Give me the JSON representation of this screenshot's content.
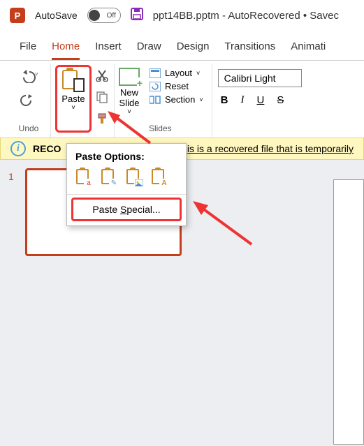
{
  "titlebar": {
    "app_letter": "P",
    "autosave_label": "AutoSave",
    "autosave_state": "Off",
    "doc_title": "ppt14BB.pptm - AutoRecovered • Savec"
  },
  "tabs": {
    "file": "File",
    "home": "Home",
    "insert": "Insert",
    "draw": "Draw",
    "design": "Design",
    "transitions": "Transitions",
    "animations": "Animati"
  },
  "ribbon": {
    "undo_group": "Undo",
    "paste_label": "Paste",
    "slides_group": "Slides",
    "new_slide": "New\nSlide",
    "layout": "Layout",
    "reset": "Reset",
    "section": "Section",
    "font_name": "Calibri Light",
    "b": "B",
    "i": "I",
    "u": "U",
    "s": "S"
  },
  "recover": {
    "bold": "RECO",
    "text": "is is a recovered file that is temporarily"
  },
  "paste_menu": {
    "title": "Paste Options:",
    "special_pre": "Paste ",
    "special_ul": "S",
    "special_post": "pecial..."
  },
  "thumb": {
    "num": "1"
  }
}
